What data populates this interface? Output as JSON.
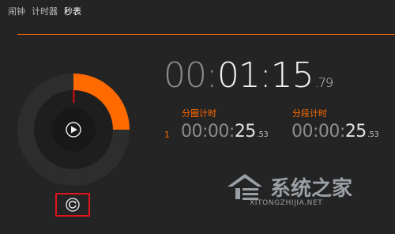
{
  "tabs": [
    {
      "label": "闹钟"
    },
    {
      "label": "计时器"
    },
    {
      "label": "秒表"
    }
  ],
  "active_tab": "秒表",
  "colors": {
    "accent": "#ff6a00",
    "background": "#242424",
    "highlight_box": "#e0141e"
  },
  "stopwatch": {
    "progress_fraction": 0.25,
    "play_icon": "play-icon",
    "reset_icon": "reset-icon",
    "main_time": {
      "dim": "00:",
      "bright": "01:15",
      "frac": ".79"
    }
  },
  "laps": {
    "lap_label": "分圈计时",
    "split_label": "分段计时",
    "rows": [
      {
        "index": "1",
        "lap": {
          "dim": "00:00:",
          "bright": "25",
          "frac": ".53"
        },
        "split": {
          "dim": "00:00:",
          "bright": "25",
          "frac": ".53"
        }
      }
    ]
  },
  "watermark": {
    "title": "系统之家",
    "subtitle": "XITONGZHIJIA.NET"
  }
}
